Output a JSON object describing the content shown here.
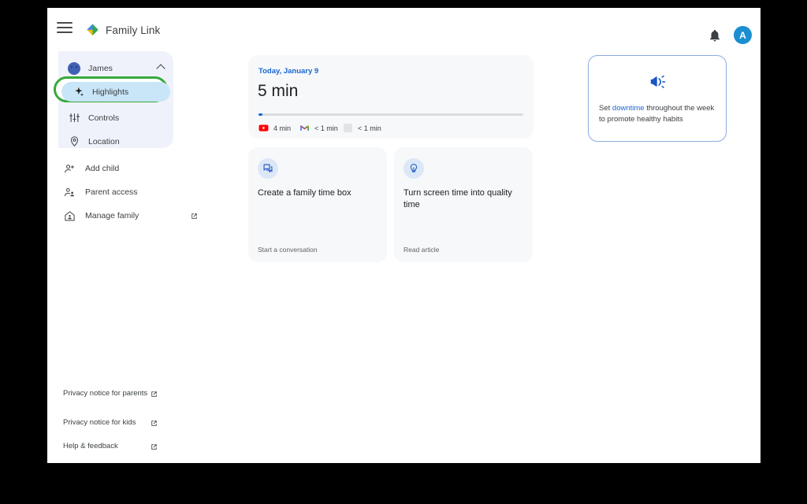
{
  "header": {
    "menu_icon": "hamburger-menu-icon",
    "logo_icon": "family-link-logo-icon",
    "title": "Family Link",
    "notifications_icon": "bell-icon",
    "avatar_initial": "A"
  },
  "sidebar": {
    "child": {
      "name": "James",
      "avatar_icon": "child-avatar-icon",
      "chevron_icon": "chevron-up-icon"
    },
    "nav_items": [
      {
        "label": "Highlights",
        "icon": "sparkle-icon",
        "selected": true
      },
      {
        "label": "Controls",
        "icon": "tune-sliders-icon",
        "selected": false
      },
      {
        "label": "Location",
        "icon": "location-pin-icon",
        "selected": false
      }
    ],
    "links": [
      {
        "label": "Add child",
        "icon": "person-add-icon",
        "external": false
      },
      {
        "label": "Parent access",
        "icon": "supervisor-account-icon",
        "external": false
      },
      {
        "label": "Manage family",
        "icon": "family-home-icon",
        "external": true
      }
    ],
    "footer_links": [
      {
        "label": "Privacy notice for parents",
        "external": true
      },
      {
        "label": "Privacy notice for kids",
        "external": true
      },
      {
        "label": "Help & feedback",
        "external": true
      }
    ]
  },
  "main": {
    "screentime": {
      "date": "Today, January 9",
      "total": "5 min",
      "progress_percent": 1.5,
      "apps": [
        {
          "name": "YouTube",
          "icon": "youtube-icon",
          "duration": "4 min"
        },
        {
          "name": "Gmail",
          "icon": "gmail-icon",
          "duration": "< 1 min"
        },
        {
          "name": "Other",
          "icon": "generic-app-icon",
          "duration": "< 1 min"
        }
      ]
    },
    "downtime_card": {
      "icon": "megaphone-icon",
      "text_before": "Set ",
      "link_text": "downtime",
      "text_after": " throughout the week to promote healthy habits"
    },
    "info_cards": [
      {
        "icon": "forum-chat-icon",
        "title": "Create a family time box",
        "action": "Start a conversation"
      },
      {
        "icon": "lightbulb-icon",
        "title": "Turn screen time into quality time",
        "action": "Read article"
      }
    ]
  },
  "colors": {
    "accent_blue": "#1967d2",
    "selected_pill": "#c9e5f8",
    "highlight_ring_green": "#37a93c",
    "card_bg": "#f6f8fa",
    "avatar_blue": "#1a8ed1",
    "youtube_red": "#ff0000"
  }
}
